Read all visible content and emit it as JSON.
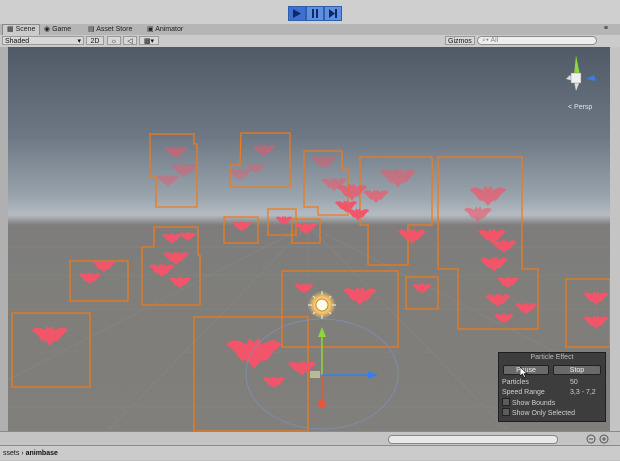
{
  "toolbar": {
    "play_icon": "play-icon",
    "pause_icon": "pause-icon",
    "step_icon": "step-icon"
  },
  "tabs": [
    {
      "label": "Scene",
      "icon": "scene-icon"
    },
    {
      "label": "Game",
      "icon": "game-icon"
    },
    {
      "label": "Asset Store",
      "icon": "asset-store-icon"
    },
    {
      "label": "Animator",
      "icon": "animator-icon"
    }
  ],
  "scene_toolbar": {
    "shading_mode": "Shaded",
    "mode_2d": "2D",
    "gizmos_label": "Gizmos",
    "search_placeholder": "All"
  },
  "gizmo": {
    "persp_label": "< Persp",
    "axis_colors": {
      "x": "#e8553a",
      "y": "#8fd63a",
      "z": "#3a7de8"
    }
  },
  "particle_panel": {
    "title": "Particle Effect",
    "pause_label": "Pause",
    "stop_label": "Stop",
    "particles_label": "Particles",
    "particles_value": "50",
    "speed_range_label": "Speed Range",
    "speed_range_value": "3,3 - 7,2",
    "show_bounds_label": "Show Bounds",
    "show_only_selected_label": "Show Only Selected"
  },
  "status": {
    "breadcrumb_prefix": "ssets",
    "breadcrumb_item": "animbase"
  },
  "colors": {
    "bounds_orange": "#f07a1a",
    "bat_pink": "#f2556a",
    "play_blue": "#3d70d2"
  }
}
